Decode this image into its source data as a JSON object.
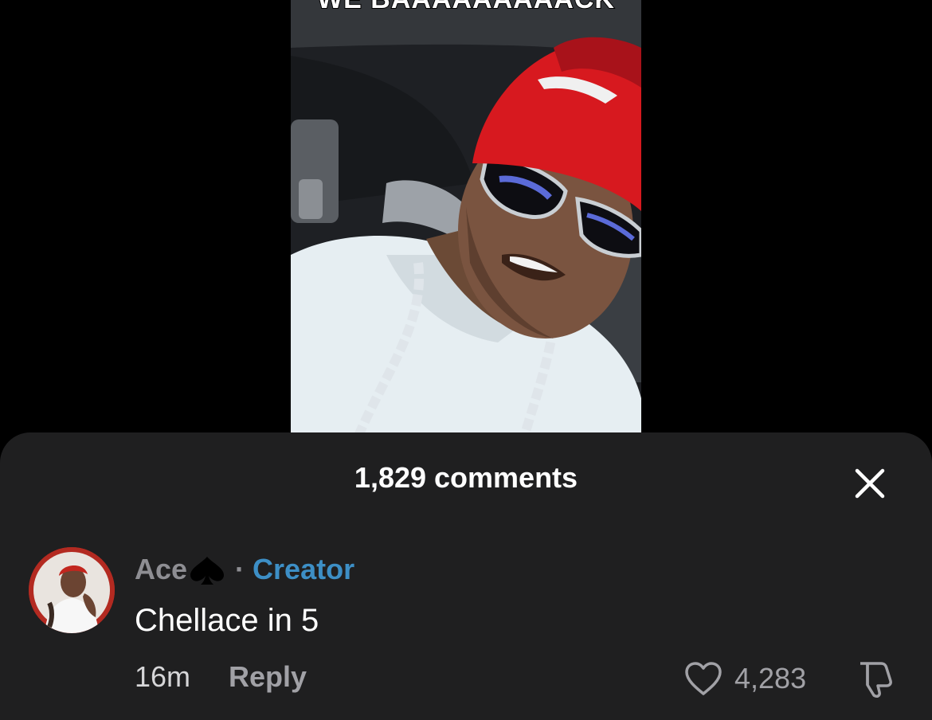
{
  "video": {
    "overlay_text": "WE BAAAAAAAAACK"
  },
  "comments_sheet": {
    "title": "1,829 comments",
    "close_icon": "close-icon",
    "comment": {
      "author": "Ace",
      "author_badge_icon": "spade-icon",
      "separator": "·",
      "role": "Creator",
      "text": "Chellace in 5",
      "time": "16m",
      "reply_label": "Reply",
      "like_icon": "heart-icon",
      "like_count": "4,283",
      "dislike_icon": "thumbs-down-icon"
    }
  },
  "colors": {
    "background": "#000000",
    "sheet": "#1f1f20",
    "creator_accent": "#3d8fc6",
    "muted_text": "#8e8e93",
    "primary_text": "#ffffff"
  }
}
